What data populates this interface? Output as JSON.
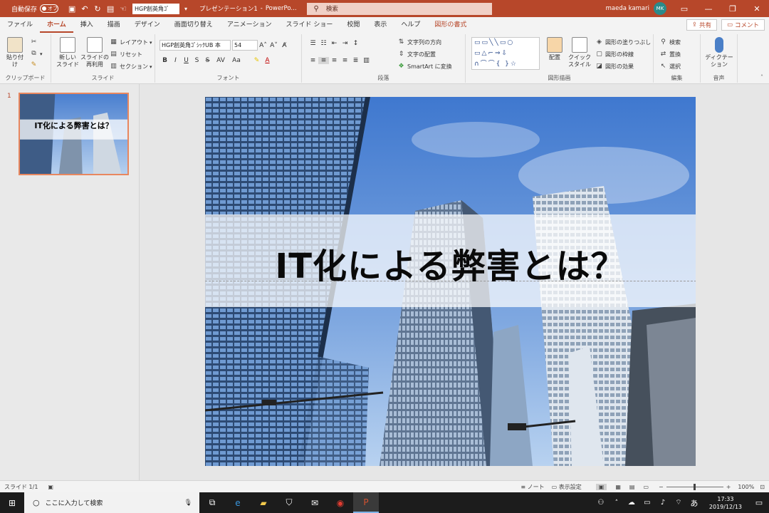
{
  "titlebar": {
    "autosave_label": "自動保存",
    "autosave_state": "オフ",
    "font_box": "HGP創英角ｺﾞ",
    "doc_title": "プレゼンテーション1",
    "app_name": "PowerPo...",
    "search_placeholder": "検索",
    "user_name": "maeda kamari",
    "user_initials": "MK"
  },
  "tabs": [
    "ファイル",
    "ホーム",
    "挿入",
    "描画",
    "デザイン",
    "画面切り替え",
    "アニメーション",
    "スライド ショー",
    "校閲",
    "表示",
    "ヘルプ",
    "図形の書式"
  ],
  "share_label": "共有",
  "comment_label": "コメント",
  "ribbon": {
    "clipboard": {
      "paste": "貼り付け",
      "label": "クリップボード"
    },
    "slides": {
      "new_slide": "新しい\nスライド",
      "reuse": "スライドの\n再利用",
      "layout": "レイアウト",
      "reset": "リセット",
      "section": "セクション",
      "label": "スライド"
    },
    "font": {
      "font_name": "HGP創英角ｺﾞｼｯｸUB 本",
      "font_size": "54",
      "bold": "B",
      "italic": "I",
      "underline": "U",
      "strike": "S",
      "shadow": "S",
      "spacing": "AV",
      "case": "Aa",
      "label": "フォント"
    },
    "paragraph": {
      "text_direction": "文字列の方向",
      "align_text": "文字の配置",
      "smartart": "SmartArt に変換",
      "label": "段落"
    },
    "drawing": {
      "arrange": "配置",
      "quick_styles": "クイック\nスタイル",
      "fill": "図形の塗りつぶし",
      "outline": "図形の枠線",
      "effects": "図形の効果",
      "label": "図形描画"
    },
    "editing": {
      "find": "検索",
      "replace": "置換",
      "select": "選択",
      "label": "編集"
    },
    "voice": {
      "dictate": "ディクテー\nション",
      "label": "音声"
    }
  },
  "thumbnail": {
    "number": "1",
    "title": "IT化による弊害とは？"
  },
  "slide": {
    "title": "IT化による弊害とは？"
  },
  "status": {
    "slide_pos": "スライド 1/1",
    "notes": "ノート",
    "display_settings": "表示設定",
    "zoom": "100%"
  },
  "taskbar": {
    "search_placeholder": "ここに入力して検索",
    "time": "17:33",
    "date": "2019/12/13",
    "ime": "あ"
  },
  "colors": {
    "accent": "#b7472a",
    "title_bar": "#b7472a",
    "sky": "#5a8fd6"
  }
}
